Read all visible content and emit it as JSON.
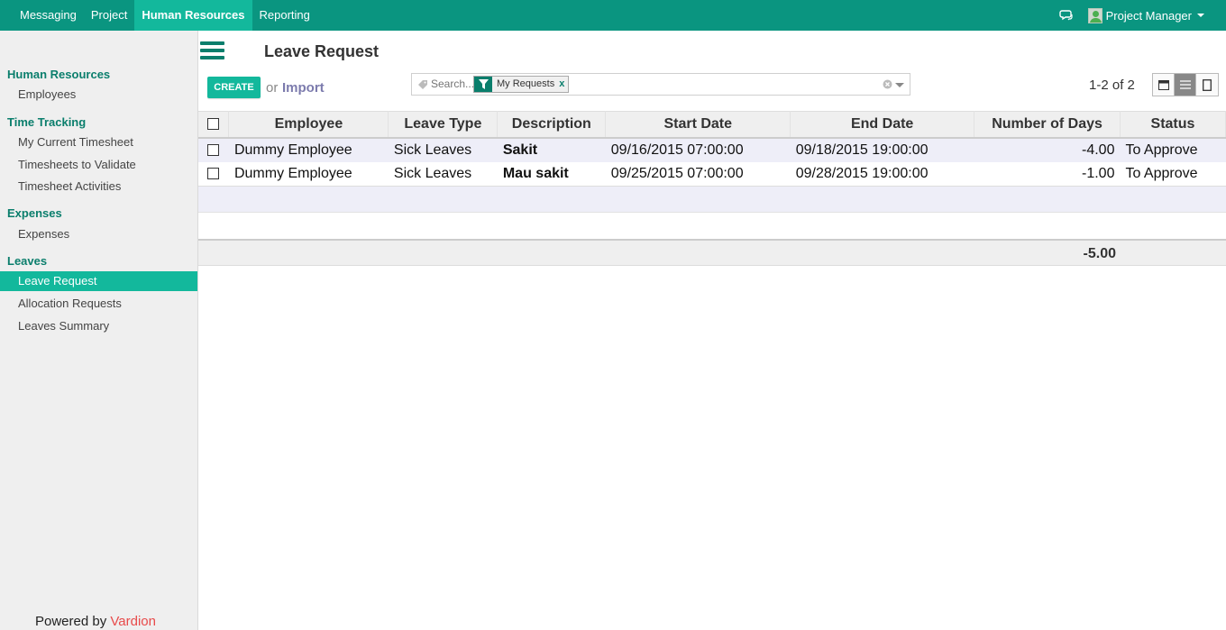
{
  "topnav": {
    "items": [
      {
        "label": "Messaging"
      },
      {
        "label": "Project"
      },
      {
        "label": "Human Resources"
      },
      {
        "label": "Reporting"
      }
    ],
    "active_index": 2,
    "user": "Project Manager",
    "icons": {
      "chat": "chat-icon",
      "avatar": "avatar"
    }
  },
  "sidebar": {
    "sections": [
      {
        "title": "Human Resources",
        "items": [
          {
            "label": "Employees"
          }
        ]
      },
      {
        "title": "Time Tracking",
        "items": [
          {
            "label": "My Current Timesheet"
          },
          {
            "label": "Timesheets to Validate"
          },
          {
            "label": "Timesheet Activities"
          }
        ]
      },
      {
        "title": "Expenses",
        "items": [
          {
            "label": "Expenses"
          }
        ]
      },
      {
        "title": "Leaves",
        "items": [
          {
            "label": "Leave Request"
          },
          {
            "label": "Allocation Requests"
          },
          {
            "label": "Leaves Summary"
          }
        ]
      }
    ],
    "active_item": "Leave Request",
    "powered_prefix": "Powered by",
    "powered_brand": "Vardion"
  },
  "header": {
    "title": "Leave Request",
    "create_label": "CREATE",
    "or_label": "or",
    "import_label": "Import"
  },
  "search": {
    "placeholder": "Search...",
    "facet_label": "My Requests",
    "facet_remove": "x"
  },
  "pager": {
    "text": "1-2 of 2"
  },
  "views": {
    "active": "list",
    "items": [
      "calendar",
      "list",
      "form"
    ]
  },
  "table": {
    "columns": [
      "Employee",
      "Leave Type",
      "Description",
      "Start Date",
      "End Date",
      "Number of Days",
      "Status"
    ],
    "rows": [
      {
        "employee": "Dummy Employee",
        "leave_type": "Sick Leaves",
        "description": "Sakit",
        "start": "09/16/2015 07:00:00",
        "end": "09/18/2015 19:00:00",
        "days": "-4.00",
        "status": "To Approve"
      },
      {
        "employee": "Dummy Employee",
        "leave_type": "Sick Leaves",
        "description": "Mau sakit",
        "start": "09/25/2015 07:00:00",
        "end": "09/28/2015 19:00:00",
        "days": "-1.00",
        "status": "To Approve"
      }
    ],
    "total_days": "-5.00"
  },
  "colors": {
    "brand": "#0a9580",
    "accent": "#13b89c",
    "import_link": "#7c7bad",
    "powered_brand": "#e84a4a"
  }
}
